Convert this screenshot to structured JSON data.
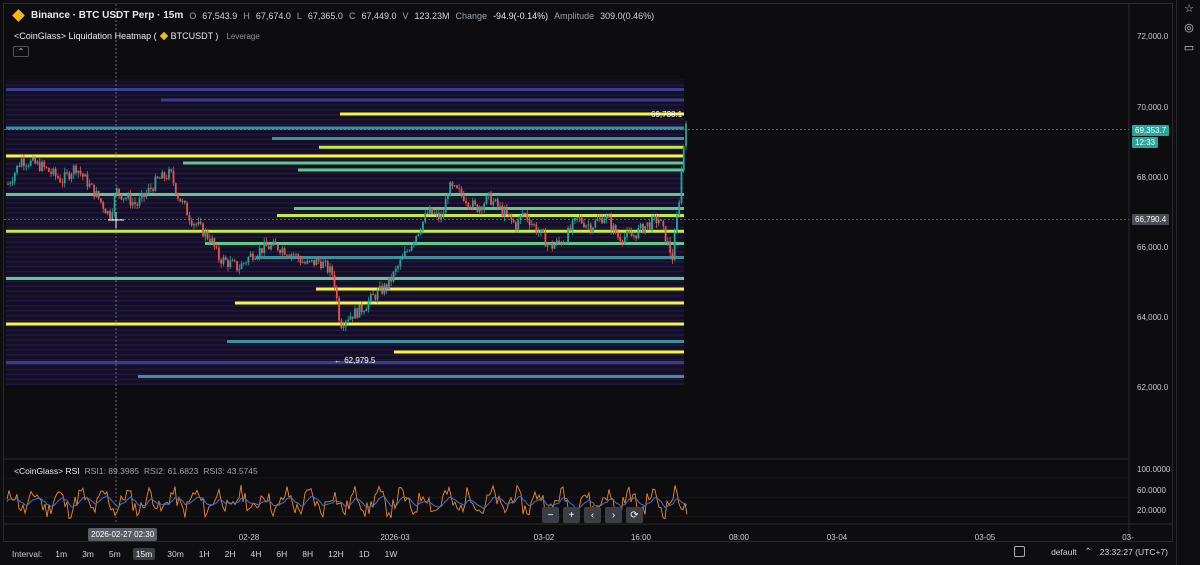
{
  "header": {
    "symbol": "Binance · BTC USDT Perp · 15m",
    "o_label": "O",
    "o_value": "67,543.9",
    "h_label": "H",
    "h_value": "67,674.0",
    "l_label": "L",
    "l_value": "67,365.0",
    "c_label": "C",
    "c_value": "67,449.0",
    "v_label": "V",
    "v_value": "123.23M",
    "change_label": "Change",
    "change_value": "-94.9(-0.14%)",
    "amp_label": "Amplitude",
    "amp_value": "309.0(0.46%)"
  },
  "indicator": {
    "title": "<CoinGlass> Liquidation Heatmap (",
    "ticker": "BTCUSDT )",
    "leverage": "Leverage",
    "collapse_glyph": "⌃"
  },
  "rsi": {
    "title": "<CoinGlass> RSI",
    "rsi1": "RSI1: 89.3985",
    "rsi2": "RSI2: 61.6823",
    "rsi3": "RSI3: 43.5745",
    "axis": [
      "100.0000",
      "60.0000",
      "20.0000"
    ]
  },
  "price_axis": [
    "72,000.0",
    "70,000.0",
    "68,000.0",
    "66,000.0",
    "64,000.0",
    "62,000.0"
  ],
  "price_tags": {
    "current_price": "69,353.7",
    "countdown": "12:33",
    "crosshair_price": "66,790.4"
  },
  "markers": {
    "high": "69,738.1",
    "low": "62,979.5"
  },
  "time_axis": [
    "02-28",
    "2026-03",
    "03-02",
    "16:00",
    "08:00",
    "03-04",
    "03-05",
    "03-"
  ],
  "crosshair_time": "2026-02-27 02:30",
  "nav_buttons": [
    "−",
    "+",
    "‹",
    "›",
    "⟳"
  ],
  "bottom_bar": {
    "interval_label": "Interval:",
    "intervals": [
      "1m",
      "3m",
      "5m",
      "15m",
      "30m",
      "1H",
      "2H",
      "4H",
      "6H",
      "8H",
      "12H",
      "1D",
      "1W"
    ],
    "active_interval": "15m",
    "theme": "default",
    "clock": "23:32:27 (UTC+7)"
  },
  "toolbar_icons": [
    "star-icon",
    "globe-icon",
    "chat-icon"
  ],
  "colors": {
    "bull": "#26a69a",
    "bear": "#ef5350",
    "heat_hot": "#f6f83a",
    "heat_cool": "#3a2f7a",
    "rsi_orange": "#f0891c",
    "rsi_blue": "#3d6fd6"
  },
  "chart_data": {
    "type": "candlestick-heatmap",
    "price_range": [
      61300,
      73000
    ],
    "candles_close_path": [
      [
        0,
        67800
      ],
      [
        0.02,
        68500
      ],
      [
        0.05,
        68300
      ],
      [
        0.08,
        67900
      ],
      [
        0.1,
        68300
      ],
      [
        0.13,
        67500
      ],
      [
        0.15,
        66900
      ],
      [
        0.16,
        67600
      ],
      [
        0.19,
        67200
      ],
      [
        0.22,
        67900
      ],
      [
        0.24,
        68100
      ],
      [
        0.25,
        67500
      ],
      [
        0.27,
        66800
      ],
      [
        0.3,
        66200
      ],
      [
        0.31,
        65700
      ],
      [
        0.34,
        65400
      ],
      [
        0.36,
        65800
      ],
      [
        0.38,
        66000
      ],
      [
        0.4,
        66000
      ],
      [
        0.42,
        65800
      ],
      [
        0.44,
        65500
      ],
      [
        0.46,
        65600
      ],
      [
        0.48,
        65200
      ],
      [
        0.49,
        63800
      ],
      [
        0.5,
        64000
      ],
      [
        0.52,
        64200
      ],
      [
        0.54,
        64600
      ],
      [
        0.56,
        64900
      ],
      [
        0.58,
        65600
      ],
      [
        0.6,
        66300
      ],
      [
        0.62,
        67000
      ],
      [
        0.64,
        66800
      ],
      [
        0.65,
        67700
      ],
      [
        0.67,
        67500
      ],
      [
        0.69,
        67100
      ],
      [
        0.71,
        67400
      ],
      [
        0.73,
        67000
      ],
      [
        0.75,
        66600
      ],
      [
        0.76,
        67000
      ],
      [
        0.78,
        66500
      ],
      [
        0.8,
        66000
      ],
      [
        0.82,
        66200
      ],
      [
        0.84,
        66800
      ],
      [
        0.86,
        66600
      ],
      [
        0.88,
        66900
      ],
      [
        0.9,
        66300
      ],
      [
        0.92,
        66300
      ],
      [
        0.94,
        66600
      ],
      [
        0.96,
        66800
      ],
      [
        0.98,
        65700
      ],
      [
        0.99,
        67400
      ],
      [
        1.0,
        69700
      ]
    ],
    "heatmap_bands": [
      {
        "price": 70500,
        "intensity": 0.3
      },
      {
        "price": 70200,
        "intensity": 0.4
      },
      {
        "price": 69800,
        "intensity": 0.95
      },
      {
        "price": 69400,
        "intensity": 0.5
      },
      {
        "price": 69100,
        "intensity": 0.55
      },
      {
        "price": 68850,
        "intensity": 0.8
      },
      {
        "price": 68600,
        "intensity": 0.9
      },
      {
        "price": 68400,
        "intensity": 0.7
      },
      {
        "price": 68200,
        "intensity": 0.6
      },
      {
        "price": 67500,
        "intensity": 0.7
      },
      {
        "price": 67100,
        "intensity": 0.6
      },
      {
        "price": 66900,
        "intensity": 0.8
      },
      {
        "price": 66450,
        "intensity": 0.85
      },
      {
        "price": 66100,
        "intensity": 0.6
      },
      {
        "price": 65700,
        "intensity": 0.5
      },
      {
        "price": 65100,
        "intensity": 0.7
      },
      {
        "price": 64800,
        "intensity": 0.9
      },
      {
        "price": 64400,
        "intensity": 0.95
      },
      {
        "price": 63800,
        "intensity": 0.9
      },
      {
        "price": 63300,
        "intensity": 0.5
      },
      {
        "price": 63000,
        "intensity": 0.9
      },
      {
        "price": 62700,
        "intensity": 0.4
      },
      {
        "price": 62300,
        "intensity": 0.5
      }
    ]
  }
}
